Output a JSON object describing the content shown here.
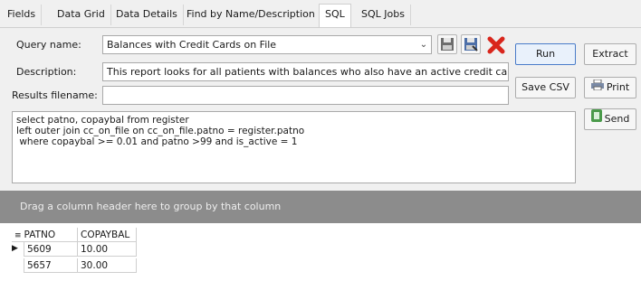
{
  "tabs": {
    "fields": "Fields",
    "data_grid": "Data Grid",
    "data_details": "Data Details",
    "find": "Find by Name/Description",
    "sql": "SQL",
    "sql_jobs": "SQL Jobs"
  },
  "form": {
    "query_name_label": "Query name:",
    "query_name_value": "Balances with Credit Cards on File",
    "description_label": "Description:",
    "description_value": "This report looks for all patients with balances who also have an active credit card",
    "results_filename_label": "Results filename:",
    "results_filename_value": "",
    "sql_text": "select patno, copaybal from register\nleft outer join cc_on_file on cc_on_file.patno = register.patno\n where copaybal >= 0.01 and patno >99 and is_active = 1"
  },
  "buttons": {
    "run": "Run",
    "extract": "Extract",
    "save_csv": "Save CSV",
    "print": "Print",
    "send": "Send"
  },
  "icons": {
    "dropdown": "chevron-down-icon",
    "save": "save-icon",
    "save_as": "save-as-icon",
    "delete": "delete-icon",
    "print": "printer-icon",
    "send": "send-icon"
  },
  "grid": {
    "group_hint": "Drag a column header here to group by that column",
    "columns": [
      "PATNO",
      "COPAYBAL"
    ],
    "rows": [
      [
        "5609",
        "10.00"
      ],
      [
        "5657",
        "30.00"
      ]
    ]
  },
  "colors": {
    "delete_red": "#d9261c",
    "group_band": "#8c8c8c",
    "primary_border": "#4a7cc9"
  }
}
